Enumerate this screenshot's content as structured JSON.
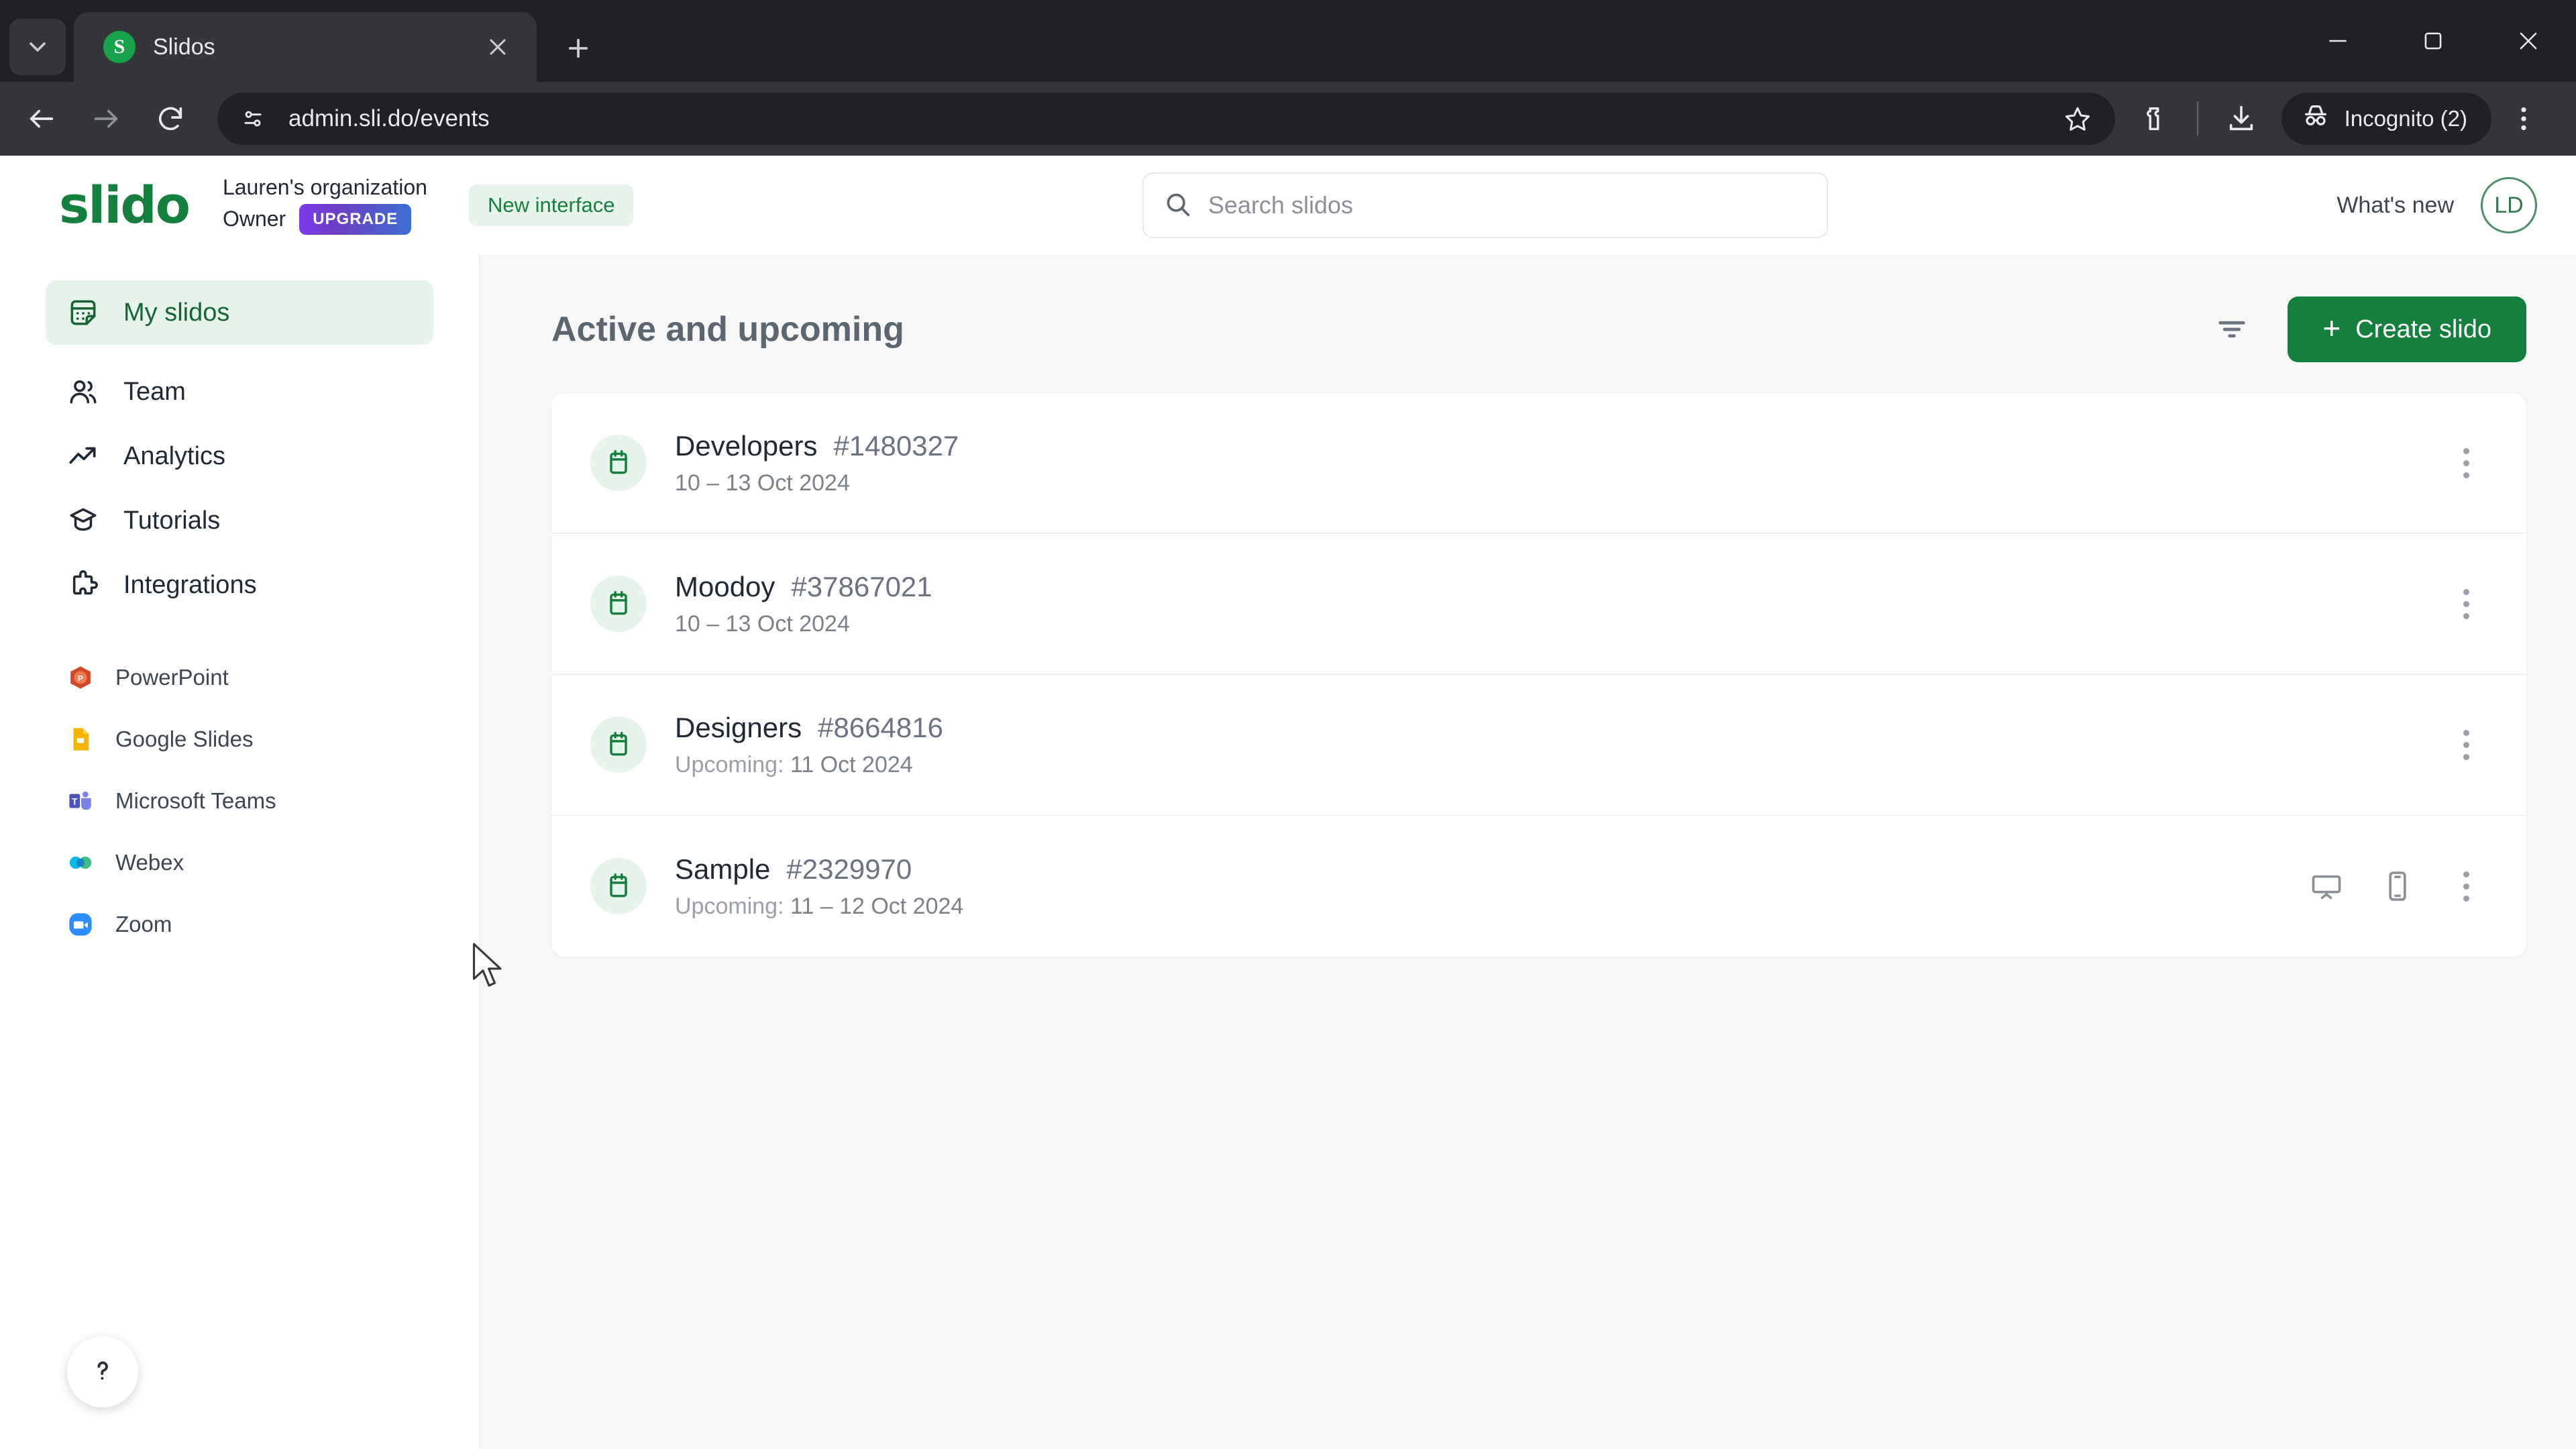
{
  "browser": {
    "tab": {
      "title": "Slidos",
      "favicon_letter": "S",
      "favicon_color": "#17a34a"
    },
    "new_tab_label": "+",
    "url": "admin.sli.do/events",
    "profile_pill": "Incognito (2)",
    "icons": {
      "tab_list": "chevron-down-icon",
      "tab_close": "close-icon",
      "back": "back-arrow-icon",
      "forward": "forward-arrow-icon",
      "reload": "reload-icon",
      "site_info": "site-settings-icon",
      "bookmark": "star-icon",
      "extensions": "extensions-icon",
      "downloads": "download-icon",
      "incognito": "incognito-icon",
      "menu": "three-dot-menu-icon",
      "minimize": "minimize-icon",
      "maximize": "maximize-icon",
      "window_close": "window-close-icon"
    }
  },
  "header": {
    "logo": "slido",
    "org_name": "Lauren's organization",
    "org_role": "Owner",
    "upgrade_label": "UPGRADE",
    "new_interface_label": "New interface",
    "whats_new_label": "What's new",
    "avatar_initials": "LD"
  },
  "search": {
    "placeholder": "Search slidos",
    "value": "",
    "icon": "search-icon"
  },
  "sidebar": {
    "items": [
      {
        "label": "My slidos",
        "icon": "calendar-grid-icon",
        "active": true
      },
      {
        "label": "Team",
        "icon": "people-icon",
        "active": false
      },
      {
        "label": "Analytics",
        "icon": "trend-up-icon",
        "active": false
      },
      {
        "label": "Tutorials",
        "icon": "graduation-cap-icon",
        "active": false
      },
      {
        "label": "Integrations",
        "icon": "puzzle-piece-icon",
        "active": false
      }
    ],
    "apps": [
      {
        "label": "PowerPoint",
        "icon": "powerpoint-icon",
        "color": "#d24726"
      },
      {
        "label": "Google Slides",
        "icon": "google-slides-icon",
        "color": "#f4b400"
      },
      {
        "label": "Microsoft Teams",
        "icon": "teams-icon",
        "color": "#4b53bc"
      },
      {
        "label": "Webex",
        "icon": "webex-icon",
        "color": "#00bceb"
      },
      {
        "label": "Zoom",
        "icon": "zoom-icon",
        "color": "#2d8cff"
      }
    ],
    "help_label": "?",
    "help_icon": "help-question-icon"
  },
  "main": {
    "title": "Active and upcoming",
    "filter_icon": "filter-icon",
    "create_label": "Create slido",
    "create_plus": "+",
    "create_color": "#15803d",
    "events": [
      {
        "name": "Developers",
        "code": "#1480327",
        "date_prefix": "",
        "date": "10 – 13 Oct 2024",
        "icon": "calendar-icon",
        "actions": [
          "kebab-menu"
        ]
      },
      {
        "name": "Moodoy",
        "code": "#37867021",
        "date_prefix": "",
        "date": "10 – 13 Oct 2024",
        "icon": "calendar-icon",
        "actions": [
          "kebab-menu"
        ]
      },
      {
        "name": "Designers",
        "code": "#8664816",
        "date_prefix": "Upcoming: ",
        "date": "11 Oct 2024",
        "icon": "calendar-icon",
        "actions": [
          "kebab-menu"
        ]
      },
      {
        "name": "Sample",
        "code": "#2329970",
        "date_prefix": "Upcoming: ",
        "date": "11 – 12 Oct 2024",
        "icon": "calendar-icon",
        "actions": [
          "present-screen-icon",
          "mobile-device-icon",
          "kebab-menu"
        ]
      }
    ]
  },
  "colors": {
    "brand_green": "#15803d",
    "light_green": "#e7f4ec",
    "page_bg": "#f7f7f7",
    "chrome_dark": "#35363a",
    "chrome_darker": "#202124"
  }
}
